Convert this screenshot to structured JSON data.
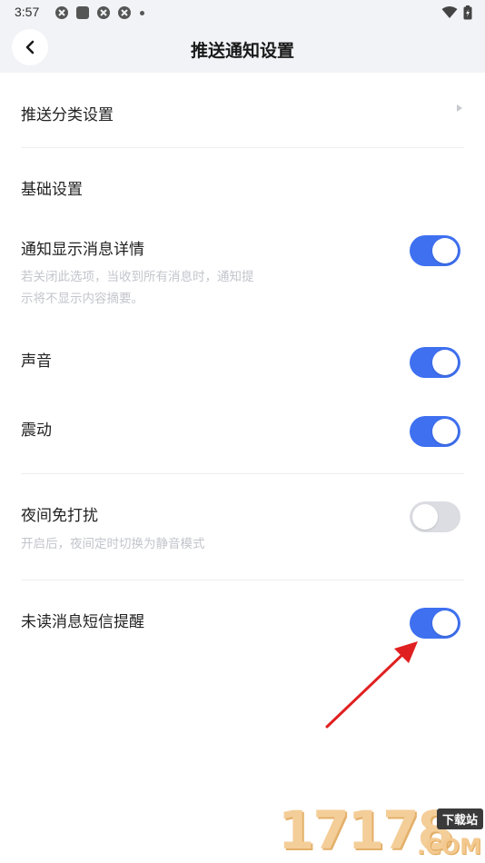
{
  "status_bar": {
    "time": "3:57",
    "icons_left": [
      "app-notification-icon",
      "square-notification-icon",
      "app-notification-icon",
      "app-notification-icon",
      "more-dot-icon"
    ],
    "icons_right": [
      "wifi-icon",
      "battery-charging-icon"
    ]
  },
  "header": {
    "title": "推送通知设置",
    "back_icon": "chevron-left-icon"
  },
  "category_row": {
    "label": "推送分类设置",
    "arrow_icon": "chevron-right-icon"
  },
  "basic_section": {
    "title": "基础设置"
  },
  "settings": {
    "show_details": {
      "label": "通知显示消息详情",
      "desc_line1": "若关闭此选项，当收到所有消息时，通知提",
      "desc_line2": "示将不显示内容摘要。",
      "enabled": true
    },
    "sound": {
      "label": "声音",
      "enabled": true
    },
    "vibrate": {
      "label": "震动",
      "enabled": true
    },
    "night_dnd": {
      "label": "夜间免打扰",
      "desc": "开启后，夜间定时切换为静音模式",
      "enabled": false
    },
    "unread_sms": {
      "label": "未读消息短信提醒",
      "enabled": true
    }
  },
  "colors": {
    "toggle_on": "#3e70f0",
    "toggle_off": "#dcdde2",
    "header_bg": "#f2f3f7",
    "annotation": "#e02020"
  },
  "watermark": {
    "digits": "17178",
    "badge": "下载站",
    "domain": ".COM"
  }
}
